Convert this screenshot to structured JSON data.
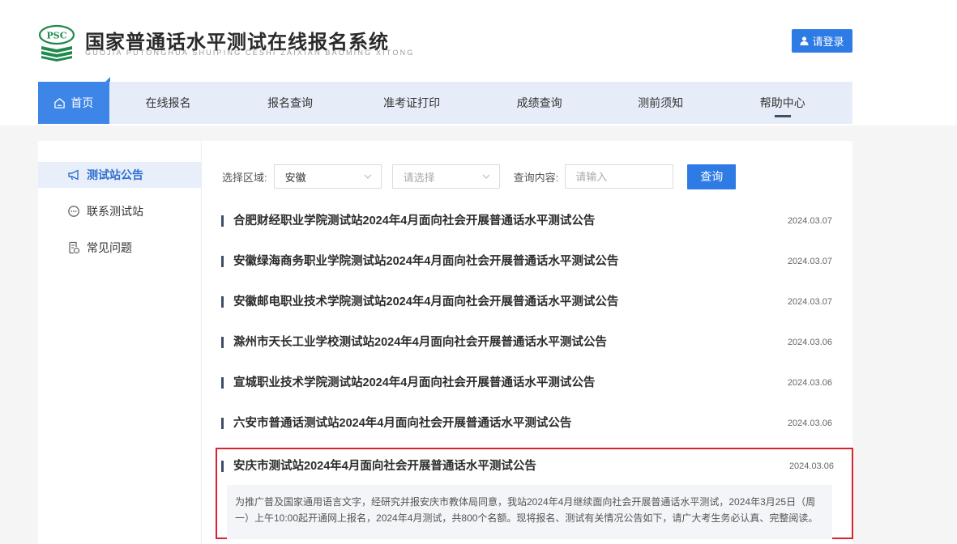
{
  "header": {
    "logo_badge": "PSC",
    "title": "国家普通话水平测试在线报名系统",
    "title_pinyin": "GUOJIA PUTONGHUA SHUIPING CESHI ZAIXIAN BAOMING XITONG",
    "login_label": "请登录"
  },
  "nav": {
    "items": [
      {
        "label": "首页",
        "icon": "home-icon"
      },
      {
        "label": "在线报名"
      },
      {
        "label": "报名查询"
      },
      {
        "label": "准考证打印"
      },
      {
        "label": "成绩查询"
      },
      {
        "label": "测前须知"
      },
      {
        "label": "帮助中心"
      }
    ],
    "active": "首页"
  },
  "sidebar": {
    "items": [
      {
        "label": "测试站公告",
        "icon": "megaphone-icon"
      },
      {
        "label": "联系测试站",
        "icon": "chat-bubble-icon"
      },
      {
        "label": "常见问题",
        "icon": "faq-document-icon"
      }
    ],
    "active": "测试站公告"
  },
  "filter": {
    "region_label": "选择区域:",
    "region_value": "安徽",
    "sub_region_placeholder": "请选择",
    "query_label": "查询内容:",
    "query_placeholder": "请输入",
    "search_label": "查询"
  },
  "announcements": [
    {
      "title": "合肥财经职业学院测试站2024年4月面向社会开展普通话水平测试公告",
      "date": "2024.03.07"
    },
    {
      "title": "安徽绿海商务职业学院测试站2024年4月面向社会开展普通话水平测试公告",
      "date": "2024.03.07"
    },
    {
      "title": "安徽邮电职业技术学院测试站2024年4月面向社会开展普通话水平测试公告",
      "date": "2024.03.07"
    },
    {
      "title": "滁州市天长工业学校测试站2024年4月面向社会开展普通话水平测试公告",
      "date": "2024.03.06"
    },
    {
      "title": "宣城职业技术学院测试站2024年4月面向社会开展普通话水平测试公告",
      "date": "2024.03.06"
    },
    {
      "title": "六安市普通话测试站2024年4月面向社会开展普通话水平测试公告",
      "date": "2024.03.06"
    }
  ],
  "expanded": {
    "title": "安庆市测试站2024年4月面向社会开展普通话水平测试公告",
    "date": "2024.03.06",
    "excerpt": "为推广普及国家通用语言文字，经研究并报安庆市教体局同意，我站2024年4月继续面向社会开展普通话水平测试，2024年3月25日（周一）上午10:00起开通网上报名，2024年4月测试，共800个名额。现将报名、测试有关情况公告如下，请广大考生务必认真、完整阅读。"
  },
  "colors": {
    "brand_blue": "#2f7be5",
    "nav_bg": "#e6edf8",
    "highlight_border": "#d9232d",
    "logo_green": "#1f8a4c"
  }
}
